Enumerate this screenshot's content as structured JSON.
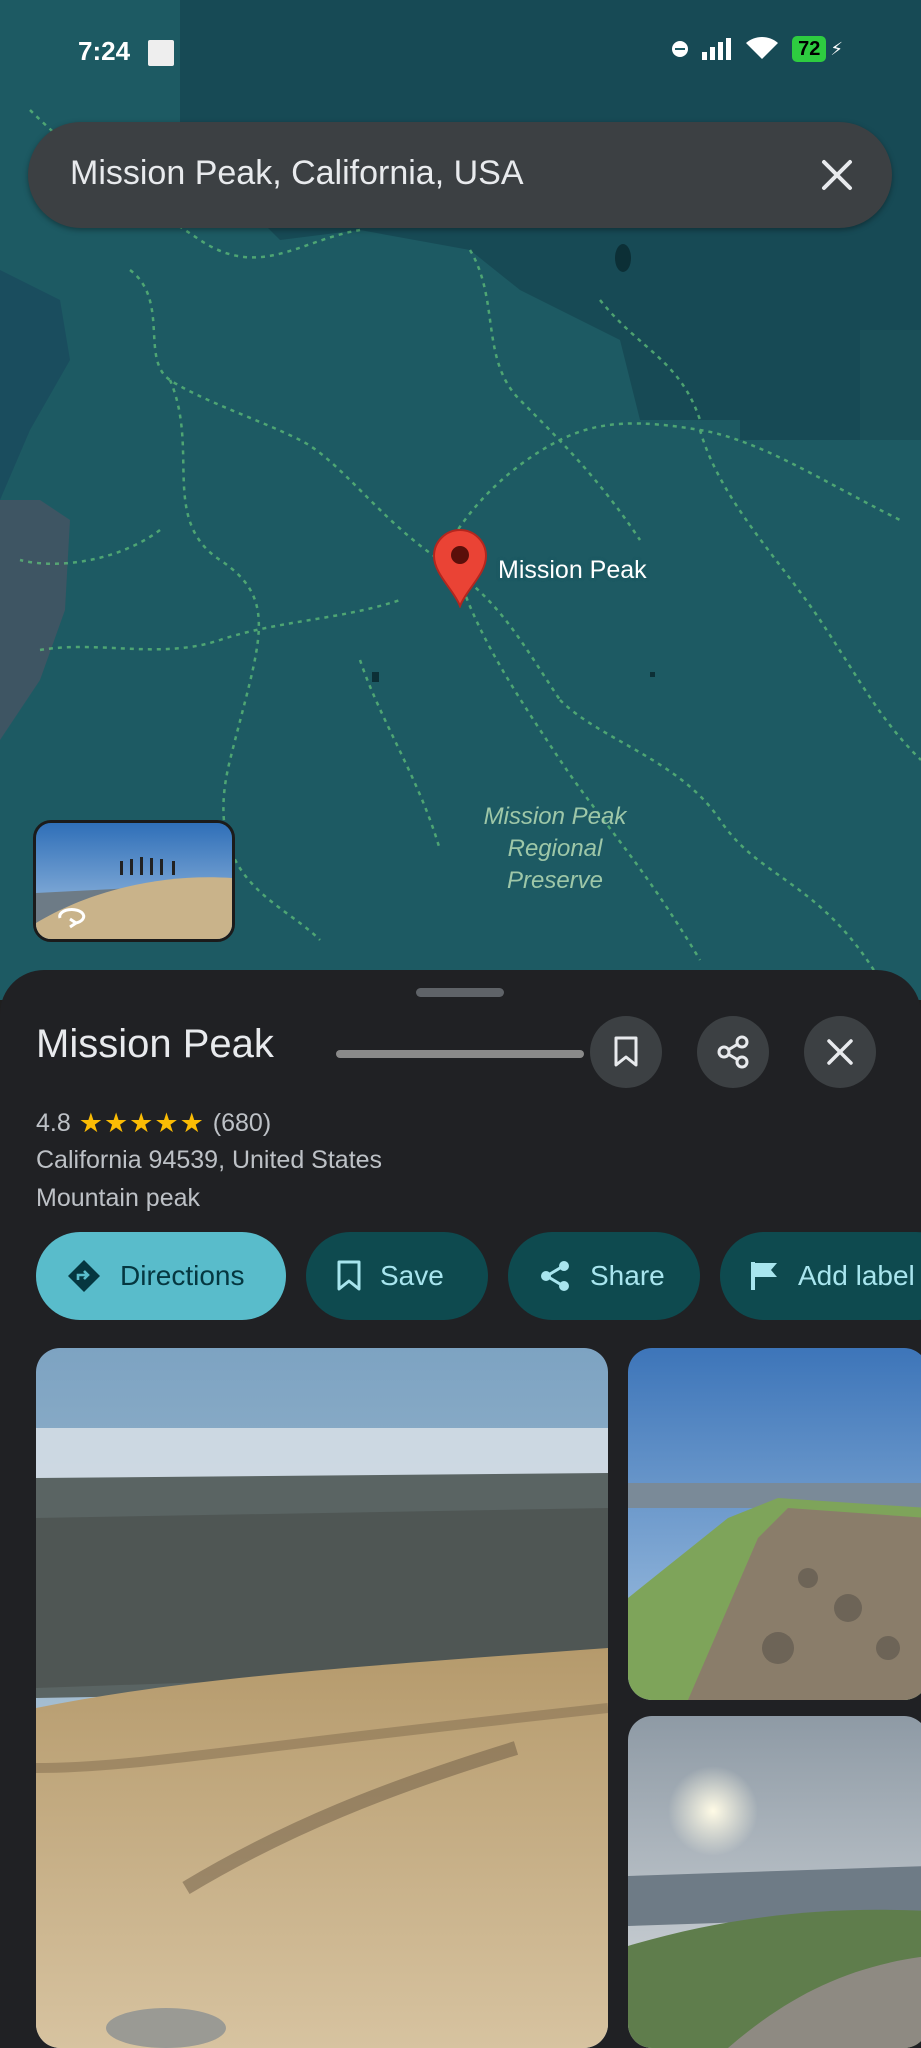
{
  "status_bar": {
    "time": "7:24",
    "battery": "72"
  },
  "search": {
    "query": "Mission Peak, California, USA"
  },
  "map": {
    "pin_label": "Mission Peak",
    "park_label_lines": [
      "Mission Peak",
      "Regional",
      "Preserve"
    ],
    "colors": {
      "background": "#1d5a63",
      "trail": "#5fbf79",
      "pin": "#ea4335"
    }
  },
  "place": {
    "name": "Mission Peak",
    "rating": "4.8",
    "stars": "★★★★★",
    "review_count": "(680)",
    "address": "California 94539, United States",
    "category": "Mountain peak"
  },
  "actions": [
    {
      "label": "Directions",
      "icon": "directions-icon"
    },
    {
      "label": "Save",
      "icon": "bookmark-icon"
    },
    {
      "label": "Share",
      "icon": "share-icon"
    },
    {
      "label": "Add label",
      "icon": "flag-icon"
    }
  ],
  "colors": {
    "sheet": "#202124",
    "chip": "#0e4a4f",
    "chip_primary": "#59bccb",
    "star": "#fbbc04"
  }
}
